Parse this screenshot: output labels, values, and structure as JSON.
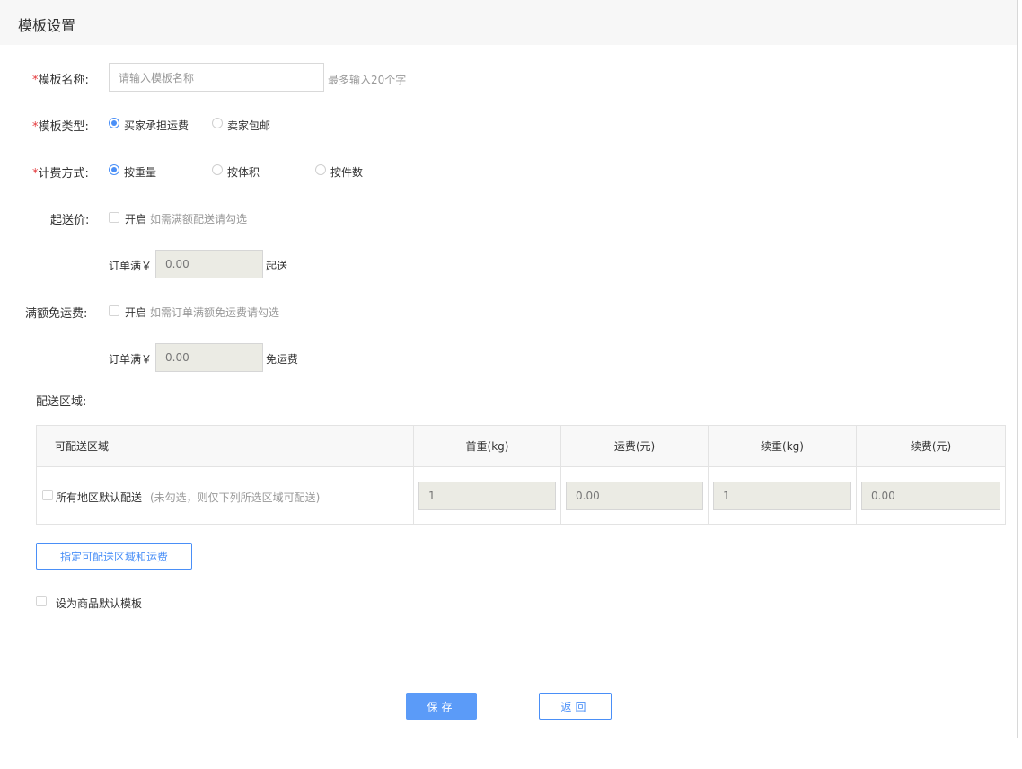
{
  "header": {
    "title": "模板设置"
  },
  "name_field": {
    "label": "模板名称:",
    "required_mark": "*",
    "placeholder": "请输入模板名称",
    "hint": "最多输入20个字"
  },
  "type_field": {
    "label": "模板类型:",
    "required_mark": "*",
    "options": [
      {
        "label": "买家承担运费",
        "selected": true
      },
      {
        "label": "卖家包邮",
        "selected": false
      }
    ]
  },
  "billing_field": {
    "label": "计费方式:",
    "required_mark": "*",
    "options": [
      {
        "label": "按重量",
        "selected": true
      },
      {
        "label": "按体积",
        "selected": false
      },
      {
        "label": "按件数",
        "selected": false
      }
    ]
  },
  "min_order": {
    "label": "起送价:",
    "enable_label": "开启",
    "hint": "如需满额配送请勾选",
    "prefix": "订单满￥",
    "value": "0.00",
    "suffix": "起送"
  },
  "free_shipping": {
    "label": "满额免运费:",
    "enable_label": "开启",
    "hint": "如需订单满额免运费请勾选",
    "prefix": "订单满￥",
    "value": "0.00",
    "suffix": "免运费"
  },
  "area": {
    "label": "配送区域:",
    "columns": [
      "可配送区域",
      "首重(kg)",
      "运费(元)",
      "续重(kg)",
      "续费(元)"
    ],
    "default_row": {
      "label": "所有地区默认配送",
      "hint": "(未勾选，则仅下列所选区域可配送)",
      "values": [
        "1",
        "0.00",
        "1",
        "0.00"
      ]
    }
  },
  "assign_button": "指定可配送区域和运费",
  "default_template_label": "设为商品默认模板",
  "actions": {
    "save": "保存",
    "back": "返回"
  },
  "colors": {
    "accent": "#4a8ff7",
    "required": "#e4393c",
    "hint": "#999999",
    "disabled_bg": "#ebebe4"
  }
}
